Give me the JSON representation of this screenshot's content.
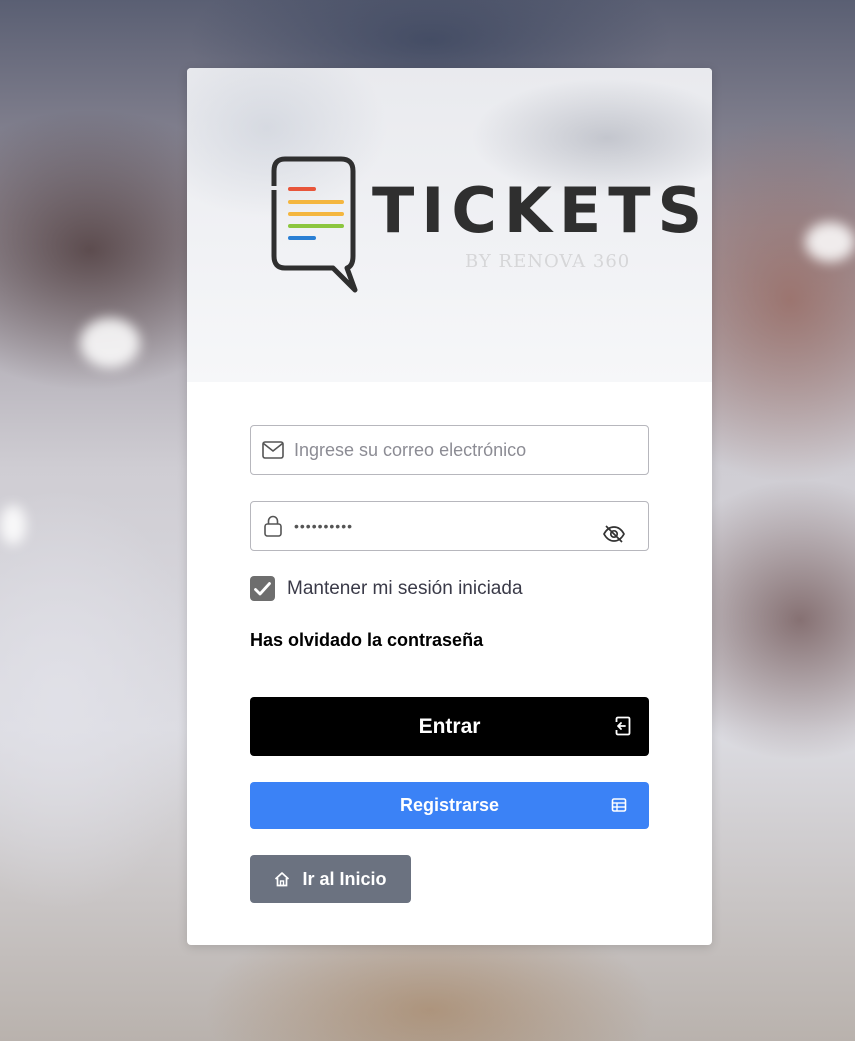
{
  "brand": {
    "name": "TICKETS",
    "tagline": "BY RENOVA 360",
    "line_colors": [
      "#e8553a",
      "#f4b63f",
      "#f4b63f",
      "#8cc63f",
      "#2a7fd4"
    ]
  },
  "form": {
    "email_placeholder": "Ingrese su correo electrónico",
    "email_value": "",
    "password_value": "••••••••••",
    "remember_label": "Mantener mi sesión iniciada",
    "remember_checked": true,
    "forgot_label": "Has olvidado la contraseña"
  },
  "buttons": {
    "login_label": "Entrar",
    "register_label": "Registrarse",
    "home_label": "Ir al Inicio"
  },
  "colors": {
    "login_bg": "#000000",
    "register_bg": "#3b82f6",
    "home_bg": "#6b7280",
    "checkbox_bg": "#6e6e6e"
  },
  "icons": {
    "email": "mail-icon",
    "password": "lock-icon",
    "toggle_password": "eye-off-icon",
    "login": "sign-in-icon",
    "register": "register-icon",
    "home": "home-icon"
  }
}
